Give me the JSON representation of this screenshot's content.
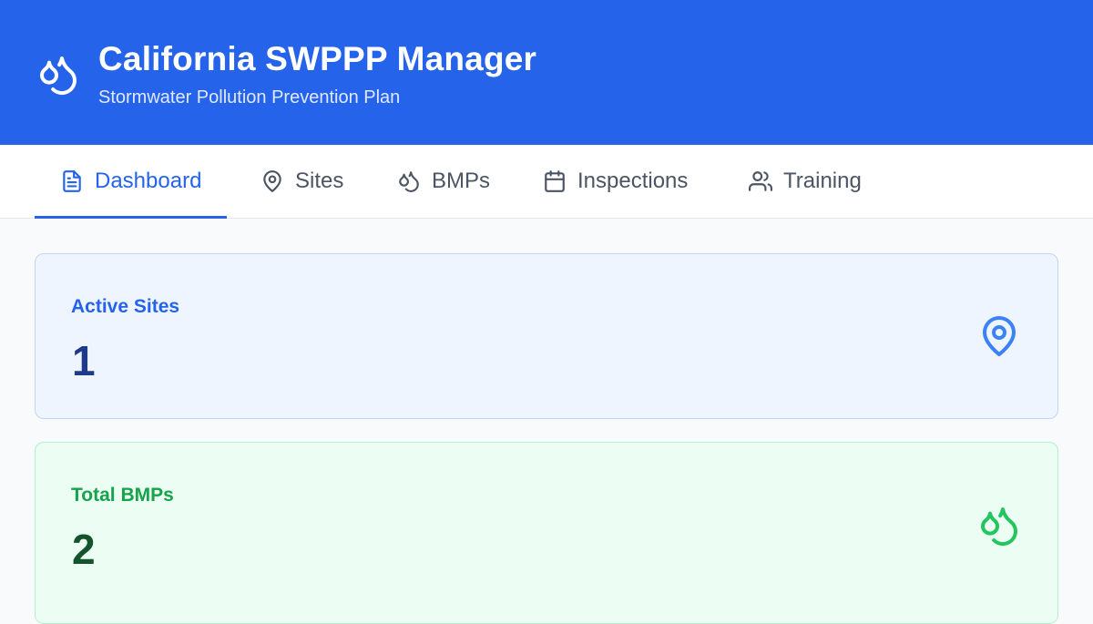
{
  "header": {
    "title": "California SWPPP Manager",
    "subtitle": "Stormwater Pollution Prevention Plan",
    "logo_icon": "droplets-icon",
    "background": "#2563eb"
  },
  "tabs": [
    {
      "label": "Dashboard",
      "icon": "file-text-icon",
      "active": true
    },
    {
      "label": "Sites",
      "icon": "map-pin-icon",
      "active": false
    },
    {
      "label": "BMPs",
      "icon": "droplets-icon",
      "active": false
    },
    {
      "label": "Inspections",
      "icon": "calendar-icon",
      "active": false
    },
    {
      "label": "Training",
      "icon": "users-icon",
      "active": false
    }
  ],
  "cards": [
    {
      "label": "Active Sites",
      "value": "1",
      "icon": "map-pin-icon",
      "accent": "#2563eb"
    },
    {
      "label": "Total BMPs",
      "value": "2",
      "icon": "droplets-icon",
      "accent": "#16a34a"
    }
  ]
}
